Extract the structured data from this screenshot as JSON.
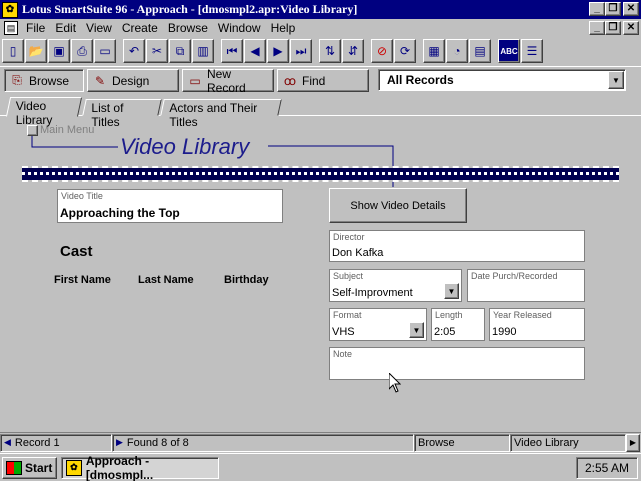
{
  "window": {
    "title": "Lotus SmartSuite 96   -  Approach - [dmosmpl2.apr:Video Library]"
  },
  "menu": [
    "File",
    "Edit",
    "View",
    "Create",
    "Browse",
    "Window",
    "Help"
  ],
  "actionbar": {
    "browse": "Browse",
    "design": "Design",
    "new_record": "New Record",
    "find": "Find",
    "record_selector": "All Records"
  },
  "tabs": [
    "Video Library",
    "List of Titles",
    "Actors and Their Titles"
  ],
  "form": {
    "main_menu": "Main Menu",
    "title": "Video Library",
    "video_title_label": "Video Title",
    "video_title_value": "Approaching the Top",
    "show_details": "Show Video Details",
    "cast_heading": "Cast",
    "cast_columns": [
      "First Name",
      "Last Name",
      "Birthday"
    ],
    "director_label": "Director",
    "director_value": "Don Kafka",
    "subject_label": "Subject",
    "subject_value": "Self-Improvment",
    "date_label": "Date Purch/Recorded",
    "date_value": "",
    "format_label": "Format",
    "format_value": "VHS",
    "length_label": "Length",
    "length_value": "2:05",
    "year_label": "Year Released",
    "year_value": "1990",
    "note_label": "Note",
    "note_value": ""
  },
  "status": {
    "record": "Record 1",
    "found": "Found 8 of 8",
    "mode": "Browse",
    "view": "Video Library"
  },
  "taskbar": {
    "start": "Start",
    "task": "Approach - [dmosmpl...",
    "clock": "2:55 AM"
  }
}
